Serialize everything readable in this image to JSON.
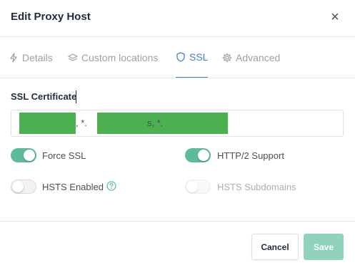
{
  "dialog": {
    "title": "Edit Proxy Host",
    "close_glyph": "×"
  },
  "tabs": [
    {
      "label": "Details",
      "icon": "lightning-icon",
      "active": false
    },
    {
      "label": "Custom locations",
      "icon": "layers-icon",
      "active": false
    },
    {
      "label": "SSL",
      "icon": "shield-icon",
      "active": true
    },
    {
      "label": "Advanced",
      "icon": "gear-icon",
      "active": false
    }
  ],
  "ssl": {
    "certificate_label": "SSL Certificate",
    "certificate_separators": [
      ", *.",
      "s, *.s"
    ],
    "redacted_color": "#4caf50"
  },
  "toggles": {
    "force_ssl": {
      "label": "Force SSL",
      "on": true
    },
    "http2": {
      "label": "HTTP/2 Support",
      "on": true
    },
    "hsts": {
      "label": "HSTS Enabled",
      "on": false
    },
    "hsts_subdomains": {
      "label": "HSTS Subdomains",
      "on": false,
      "disabled": true
    }
  },
  "footer": {
    "cancel_label": "Cancel",
    "save_label": "Save"
  },
  "colors": {
    "accent": "#467fcf",
    "toggle_on": "#5eba9c",
    "save_button": "#8fd2be"
  }
}
